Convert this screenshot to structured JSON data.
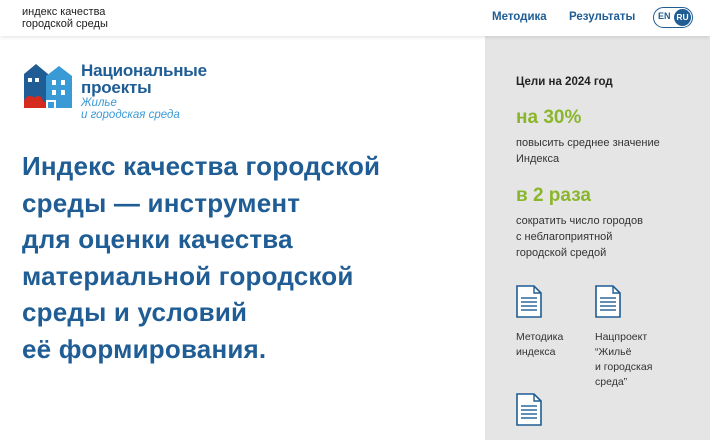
{
  "header": {
    "site_name_line1": "индекс качества",
    "site_name_line2": "городской среды",
    "nav": {
      "methodology": "Методика",
      "results": "Результаты"
    },
    "lang": {
      "en": "EN",
      "ru": "RU",
      "active": "RU"
    }
  },
  "logo": {
    "title_line1": "Национальные",
    "title_line2": "проекты",
    "subtitle_line1": "Жилье",
    "subtitle_line2": "и городская среда"
  },
  "headline": {
    "line1": "Индекс качества городской",
    "line2": "среды — инструмент",
    "line3": "для оценки качества",
    "line4": "материальной городской",
    "line5": "среды и условий",
    "line6": "её формирования."
  },
  "sidebar": {
    "goals_title": "Цели на 2024 год",
    "goals": [
      {
        "value": "на 30%",
        "desc_line1": "повысить среднее значение",
        "desc_line2": "Индекса"
      },
      {
        "value": "в 2 раза",
        "desc_line1": "сократить число городов",
        "desc_line2": "с неблагоприятной",
        "desc_line3": "городской средой"
      }
    ],
    "documents": [
      {
        "icon": "document-icon",
        "line1": "Методика",
        "line2": "индекса"
      },
      {
        "icon": "document-icon",
        "line1": "Нацпроект",
        "line2": "“Жильё",
        "line3": "и городская",
        "line4": "среда”"
      },
      {
        "icon": "document-icon"
      }
    ]
  },
  "colors": {
    "brand_blue": "#1f5d94",
    "light_blue": "#3a9ad6",
    "accent_green": "#8ab62b",
    "logo_red": "#d52b1e",
    "sidebar_bg": "#e5e5e5"
  }
}
